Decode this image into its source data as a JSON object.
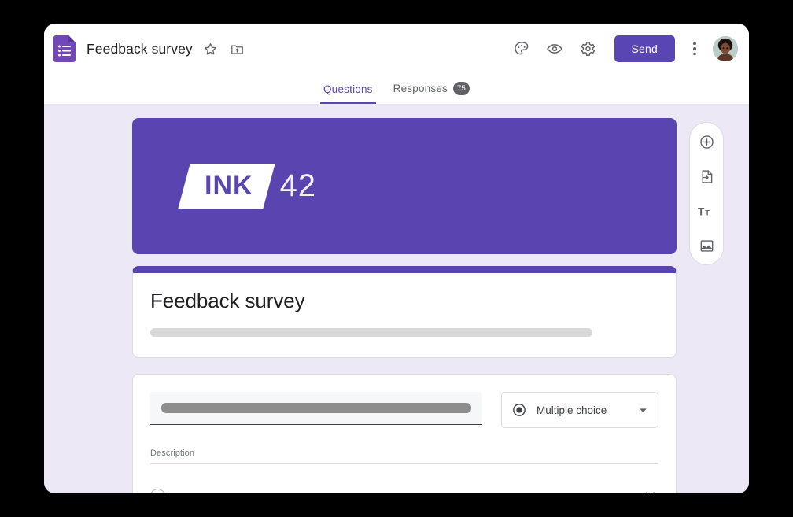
{
  "app": {
    "logo_icon": "google-forms-icon",
    "doc_title": "Feedback survey",
    "star_icon": "star-icon",
    "move_folder_icon": "move-to-folder-icon"
  },
  "toolbar": {
    "theme_icon": "palette-icon",
    "preview_icon": "eye-preview-icon",
    "settings_icon": "gear-icon",
    "send_label": "Send",
    "more_icon": "kebab-menu-icon",
    "avatar_icon": "user-avatar"
  },
  "tabs": [
    {
      "label": "Questions",
      "active": true,
      "badge": ""
    },
    {
      "label": "Responses",
      "active": false,
      "badge": "75"
    }
  ],
  "banner": {
    "logo_text": "INK",
    "logo_number": "42",
    "background_color": "#5a45b0"
  },
  "form_header": {
    "title": "Feedback survey",
    "description_redacted": true
  },
  "question": {
    "title_redacted": true,
    "type_label": "Multiple choice",
    "type_icon": "radio-button-icon",
    "dropdown_icon": "chevron-down-icon",
    "description_placeholder": "Description",
    "option_icon": "radio-circle-icon",
    "option_value": "",
    "remove_icon": "close-x-icon"
  },
  "side_toolbar": {
    "items": [
      {
        "icon": "add-question-icon"
      },
      {
        "icon": "import-questions-icon"
      },
      {
        "icon": "add-title-icon"
      },
      {
        "icon": "add-image-icon"
      }
    ]
  },
  "colors": {
    "accent": "#5a45b5",
    "banner": "#5a45b0",
    "canvas": "#ece8f6"
  }
}
